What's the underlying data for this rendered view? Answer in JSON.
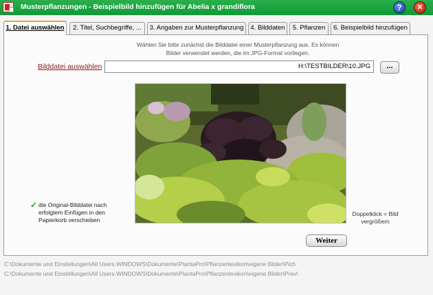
{
  "window": {
    "title": "Musterpflanzungen - Beispielbild hinzufügen für Abelia x grandiflora",
    "help_label": "?",
    "close_label": "✕"
  },
  "tabs": [
    {
      "label": "1. Datei auswählen",
      "active": true
    },
    {
      "label": "2. Titel, Suchbegriffe, ...",
      "active": false
    },
    {
      "label": "3. Angaben zur Musterpflanzung",
      "active": false
    },
    {
      "label": "4. Bilddaten",
      "active": false
    },
    {
      "label": "5. Pflanzen",
      "active": false
    },
    {
      "label": "6. Beispielbild hinzufügen",
      "active": false
    }
  ],
  "panel": {
    "info_text": "Wählen Sie bitte zunächst die Bilddatei einer Musterpflanzung aus. Es können Bilder verwendet werden, die im JPG-Format vorliegen.",
    "file_label": "Bilddatei auswählen",
    "file_path": "H:\\TESTBILDER\\10.JPG",
    "browse_label": "...",
    "check_icon": "✓",
    "checkbox_text": "die Original-Bilddatei nach erfolgtem Einfügen in den Papierkorb verschieben",
    "hint_text": "Doppelklick = Bild vergrößern",
    "next_button": "Weiter"
  },
  "paths": [
    "C:\\Dokumente und Einstellungen\\All Users.WINDOWS\\Dokumente\\PlantaPro\\Pflanzenlexikon\\eigene Bilder\\Pict\\",
    "C:\\Dokumente und Einstellungen\\All Users.WINDOWS\\Dokumente\\PlantaPro\\Pflanzenlexikon\\eigene Bilder\\Prev\\"
  ],
  "colors": {
    "titlebar": "#17a13c",
    "active_tab_accent": "#e8a23c",
    "file_label": "#8b1a1a"
  }
}
